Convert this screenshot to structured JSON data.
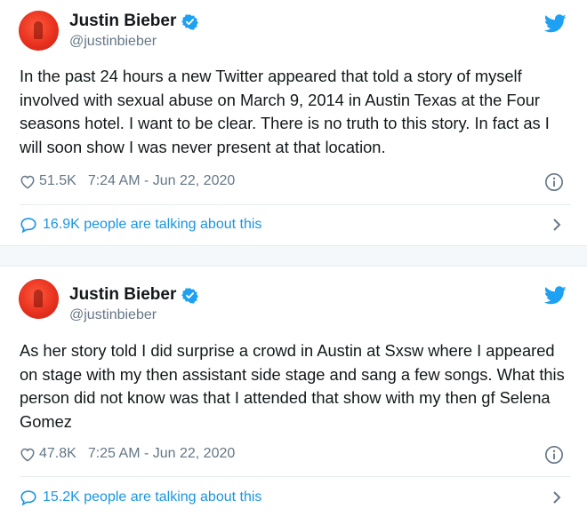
{
  "tweets": [
    {
      "author": {
        "name": "Justin Bieber",
        "handle": "@justinbieber",
        "verified": true
      },
      "text": "In the past 24 hours a new Twitter appeared that told a story of myself involved with sexual abuse on March 9, 2014 in Austin Texas at the Four seasons hotel. I want to be clear. There is no truth to this story. In fact as I will soon show I was never present at that location.",
      "likes": "51.5K",
      "timestamp": "7:24 AM - Jun 22, 2020",
      "talking": "16.9K people are talking about this"
    },
    {
      "author": {
        "name": "Justin Bieber",
        "handle": "@justinbieber",
        "verified": true
      },
      "text": "As her story told I did surprise a crowd in Austin at Sxsw where I appeared on stage with my then assistant side stage and sang a few songs. What this person did not know was that I attended that show with my then gf Selena Gomez",
      "likes": "47.8K",
      "timestamp": "7:25 AM - Jun 22, 2020",
      "talking": "15.2K people are talking about this"
    }
  ],
  "colors": {
    "accent": "#1b95e0",
    "twitter_blue": "#1da1f2",
    "muted": "#657786",
    "avatar_red": "#e8321f"
  },
  "icons": [
    "verified-badge-icon",
    "twitter-bird-icon",
    "heart-icon",
    "info-icon",
    "comment-bubble-icon",
    "chevron-right-icon"
  ]
}
